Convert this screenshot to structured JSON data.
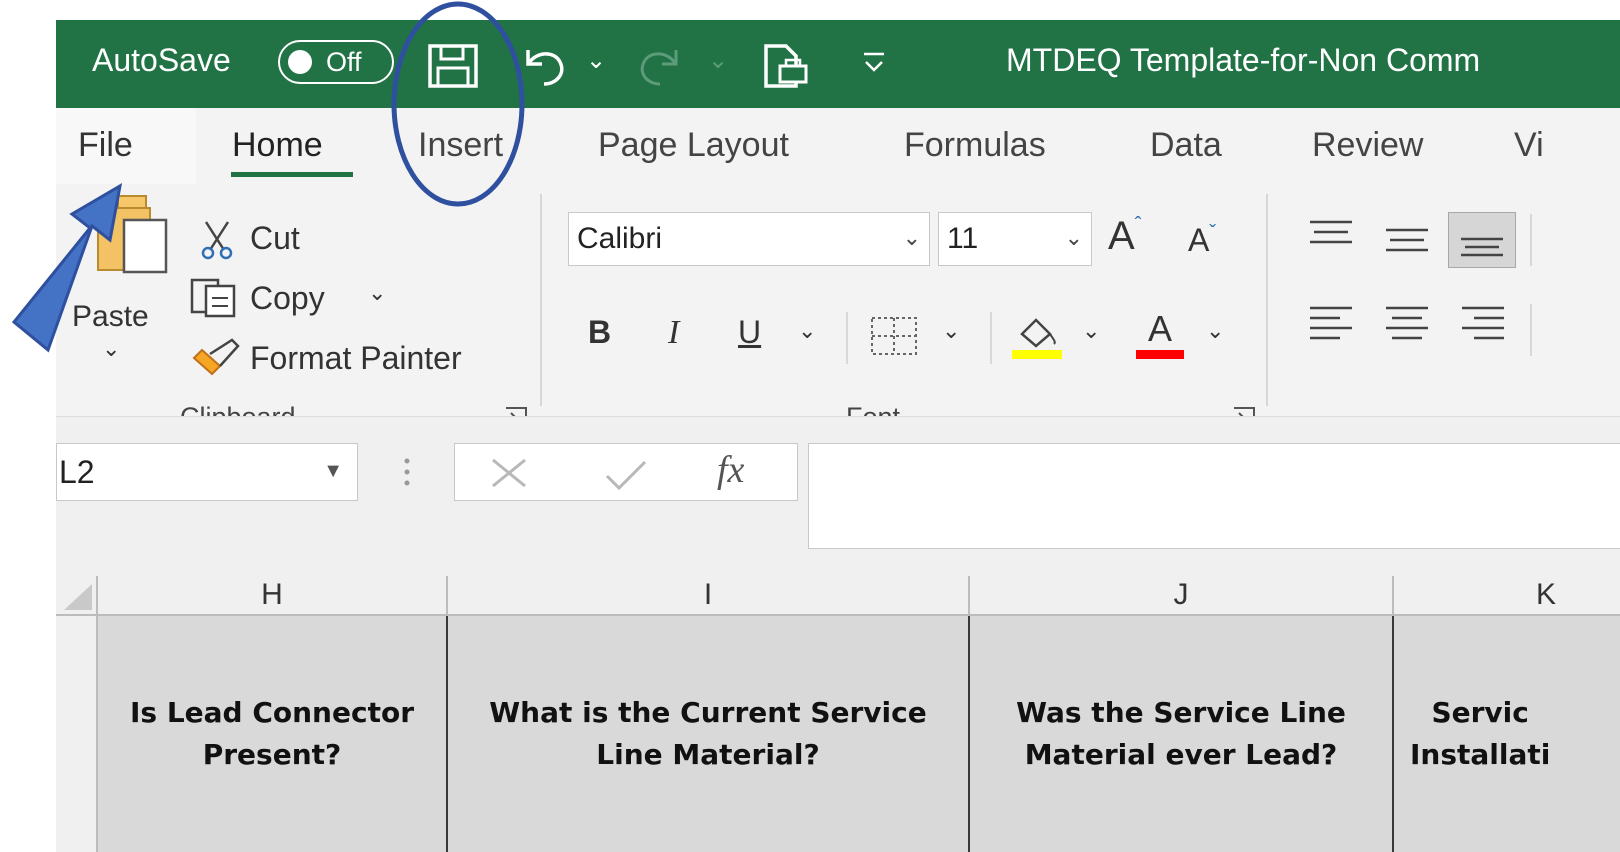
{
  "titlebar": {
    "autosave_label": "AutoSave",
    "toggle_state": "Off",
    "document_title": "MTDEQ Template-for-Non Comm"
  },
  "tabs": [
    {
      "label": "File"
    },
    {
      "label": "Home"
    },
    {
      "label": "Insert"
    },
    {
      "label": "Page Layout"
    },
    {
      "label": "Formulas"
    },
    {
      "label": "Data"
    },
    {
      "label": "Review"
    },
    {
      "label": "Vi"
    }
  ],
  "clipboard": {
    "paste_label": "Paste",
    "cut_label": "Cut",
    "copy_label": "Copy",
    "format_painter_label": "Format Painter",
    "group_label": "Clipboard"
  },
  "font": {
    "font_name": "Calibri",
    "font_size": "11",
    "bold": "B",
    "italic": "I",
    "underline": "U",
    "font_color_letter": "A",
    "group_label": "Font",
    "fill_color": "#ffff00",
    "font_color": "#ff0000"
  },
  "formula_bar": {
    "name_box": "L2",
    "fx": "fx"
  },
  "grid": {
    "columns": [
      "H",
      "I",
      "J",
      "K"
    ],
    "cells": [
      {
        "line1": "Is Lead Connector",
        "line2": "Present?"
      },
      {
        "line1": "What is the Current Service",
        "line2": "Line Material?"
      },
      {
        "line1": "Was the Service Line",
        "line2": "Material ever Lead?"
      },
      {
        "line1": "Servic",
        "line2": "Installati"
      }
    ]
  },
  "colors": {
    "titlebar": "#217346",
    "annotation": "#2f4f9f",
    "arrow_fill": "#4472c4"
  }
}
